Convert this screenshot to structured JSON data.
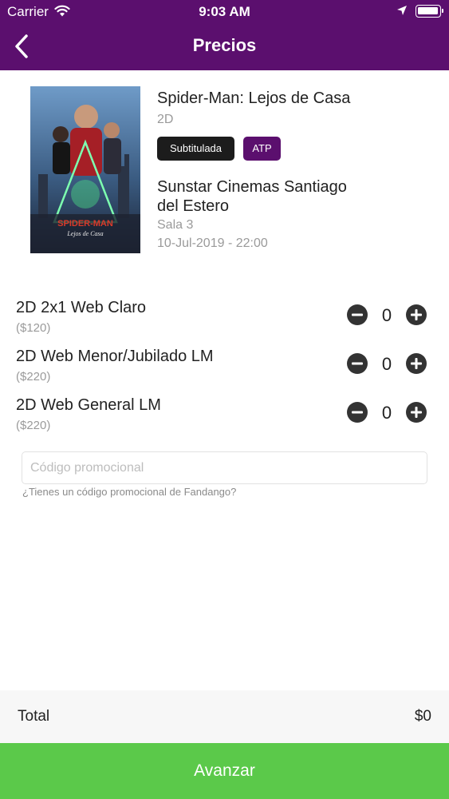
{
  "status_bar": {
    "carrier": "Carrier",
    "time": "9:03 AM"
  },
  "nav": {
    "title": "Precios",
    "back_icon": "chevron-left-icon"
  },
  "movie": {
    "title": "Spider-Man: Lejos de Casa",
    "format": "2D",
    "badges": [
      "Subtitulada",
      "ATP"
    ],
    "cinema": "Sunstar Cinemas Santiago del Estero",
    "room": "Sala 3",
    "datetime": "10-Jul-2019 - 22:00",
    "poster": {
      "title_text": "SPIDER-MAN",
      "subtitle_text": "Lejos de Casa"
    }
  },
  "tickets": [
    {
      "name": "2D 2x1 Web Claro",
      "price": "($120)",
      "quantity": "0"
    },
    {
      "name": "2D Web Menor/Jubilado LM",
      "price": "($220)",
      "quantity": "0"
    },
    {
      "name": "2D Web General LM",
      "price": "($220)",
      "quantity": "0"
    }
  ],
  "promo": {
    "placeholder": "Código promocional",
    "value": "",
    "hint": "¿Tienes un código promocional de Fandango?"
  },
  "footer": {
    "total_label": "Total",
    "total_value": "$0",
    "next_label": "Avanzar"
  },
  "colors": {
    "brand": "#5b0f6e",
    "button": "#5bc94a",
    "badge_dark": "#1c1c1c"
  }
}
